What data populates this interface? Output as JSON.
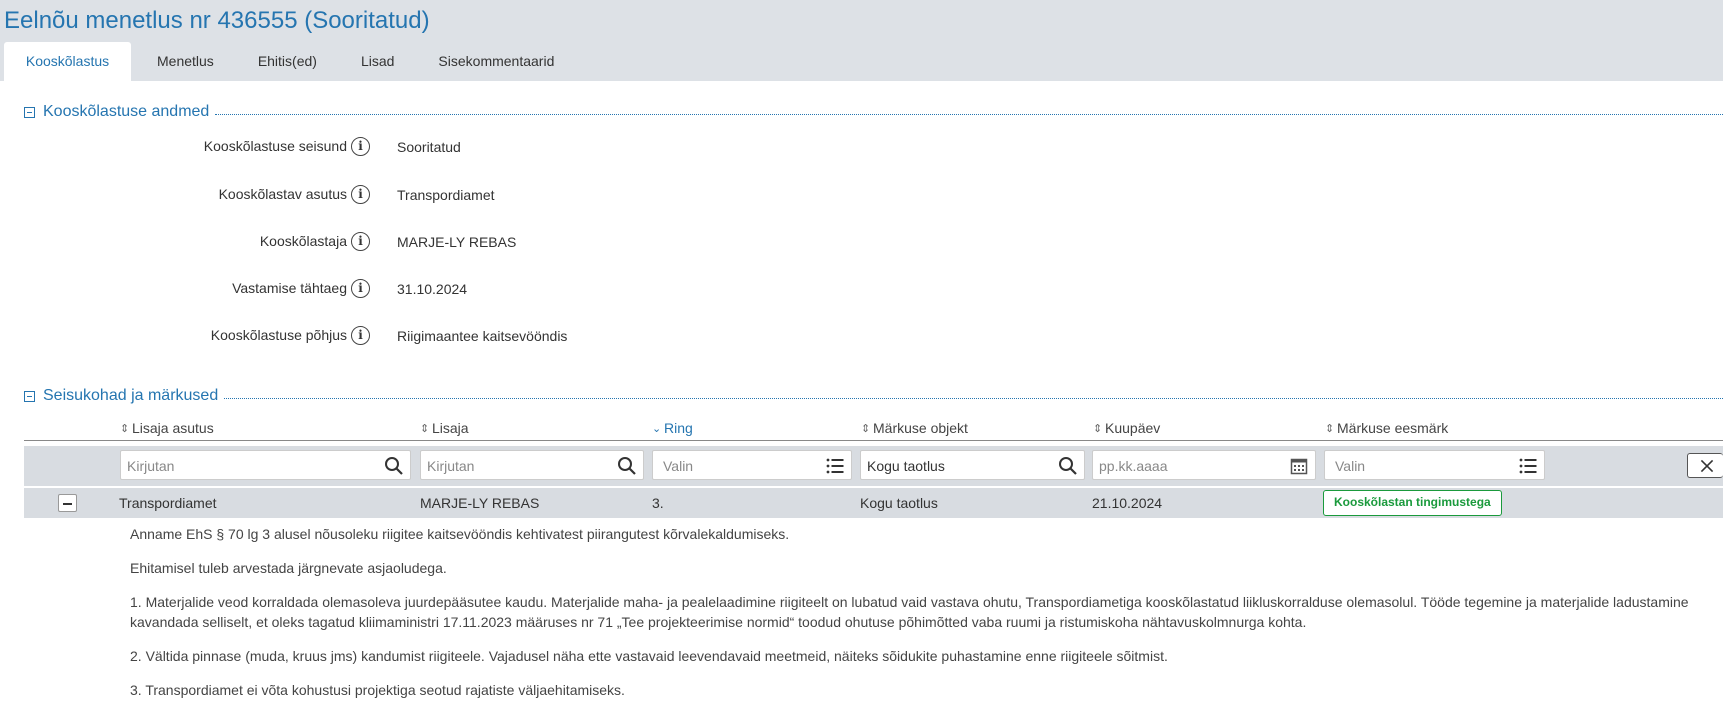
{
  "page": {
    "title": "Eelnõu menetlus nr 436555 (Sooritatud)"
  },
  "tabs": [
    {
      "label": "Kooskõlastus",
      "active": true
    },
    {
      "label": "Menetlus",
      "active": false
    },
    {
      "label": "Ehitis(ed)",
      "active": false
    },
    {
      "label": "Lisad",
      "active": false
    },
    {
      "label": "Sisekommentaarid",
      "active": false
    }
  ],
  "coordination": {
    "section_title": "Kooskõlastuse andmed",
    "fields": [
      {
        "label": "Kooskõlastuse seisund",
        "value": "Sooritatud"
      },
      {
        "label": "Kooskõlastav asutus",
        "value": "Transpordiamet"
      },
      {
        "label": "Kooskõlastaja",
        "value": "MARJE-LY REBAS"
      },
      {
        "label": "Vastamise tähtaeg",
        "value": "31.10.2024"
      },
      {
        "label": "Kooskõlastuse põhjus",
        "value": "Riigimaantee kaitsevööndis"
      }
    ]
  },
  "remarks": {
    "section_title": "Seisukohad ja märkused",
    "columns": [
      {
        "label": "Lisaja asutus",
        "sort": "none"
      },
      {
        "label": "Lisaja",
        "sort": "none"
      },
      {
        "label": "Ring",
        "sort": "desc"
      },
      {
        "label": "Märkuse objekt",
        "sort": "none"
      },
      {
        "label": "Kuupäev",
        "sort": "none"
      },
      {
        "label": "Märkuse eesmärk",
        "sort": "none"
      }
    ],
    "filters": {
      "agency": {
        "value": "",
        "placeholder": "Kirjutan"
      },
      "adder": {
        "value": "",
        "placeholder": "Kirjutan"
      },
      "round": {
        "value": "",
        "placeholder": "Valin"
      },
      "object": {
        "value": "Kogu taotlus",
        "placeholder": ""
      },
      "date": {
        "value": "",
        "placeholder": "pp.kk.aaaa"
      },
      "purpose": {
        "value": "",
        "placeholder": "Valin"
      }
    },
    "rows": [
      {
        "agency": "Transpordiamet",
        "adder": "MARJE-LY REBAS",
        "round": "3.",
        "object": "Kogu taotlus",
        "date": "21.10.2024",
        "purpose": "Kooskõlastan tingimustega",
        "comments": [
          "Anname EhS § 70 lg 3 alusel nõusoleku riigitee kaitsevööndis kehtivatest piirangutest kõrvalekaldumiseks.",
          "Ehitamisel tuleb arvestada järgnevate asjaoludega.",
          "1. Materjalide veod korraldada olemasoleva juurdepääsutee kaudu. Materjalide maha- ja pealelaadimine riigiteelt on lubatud vaid vastava ohutu, Transpordiametiga kooskõlastatud liikluskorralduse olemasolul. Tööde tegemine ja materjalide ladustamine kavandada selliselt, et oleks tagatud kliimaministri 17.11.2023 määruses nr 71 „Tee projekteerimise normid“ toodud ohutuse põhimõtted vaba ruumi ja ristumiskoha nähtavuskolmnurga kohta.",
          "2. Vältida pinnase (muda, kruus jms) kandumist riigiteele. Vajadusel näha ette vastavaid leevendavaid meetmeid, näiteks sõidukite puhastamine enne riigiteele sõitmist.",
          "3. Transpordiamet ei võta kohustusi projektiga seotud rajatiste väljaehitamiseks."
        ]
      }
    ]
  },
  "icons": {
    "info": "info-icon",
    "search": "search-icon",
    "list": "list-icon",
    "calendar": "calendar-icon",
    "close": "close-icon"
  },
  "colors": {
    "accent": "#2575b0",
    "success": "#1a9a3c",
    "header_bg": "#dde1e6"
  }
}
